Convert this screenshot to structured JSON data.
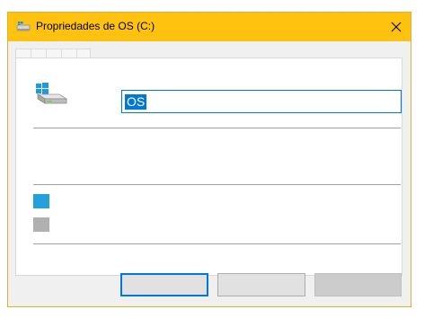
{
  "window": {
    "title": "Propriedades de OS (C:)",
    "title_icon": "drive-icon",
    "close_glyph": "✕",
    "titlebar_color": "#ffc20e"
  },
  "general": {
    "drive_name_value": "OS",
    "drive_icon": "windows-drive-icon"
  },
  "legend": {
    "used_color": "#26a0da",
    "free_color": "#b0b0b0"
  },
  "buttons": {
    "ok_label": "",
    "cancel_label": "",
    "apply_label": ""
  }
}
